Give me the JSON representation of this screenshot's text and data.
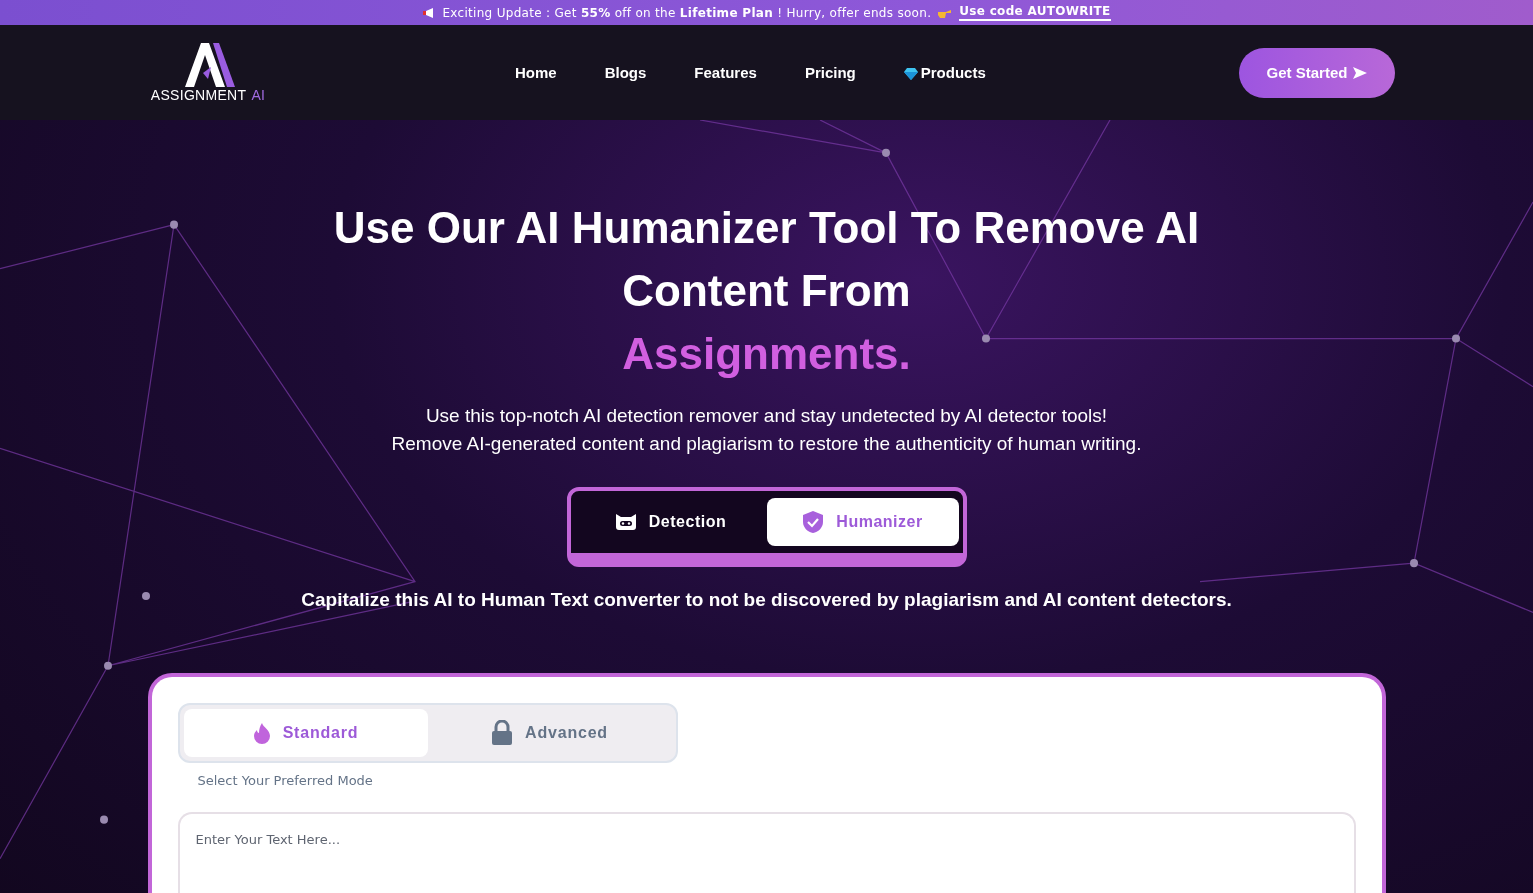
{
  "announcement": {
    "text": "Exciting Update : Get **55%** off on the **Lifetime Plan** ! Hurry, offer ends soon.",
    "link": "Use code **AUTOWRITE**"
  },
  "logo": {
    "name": "ASSIGNMENT",
    "suffix": "AI"
  },
  "nav": [
    {
      "label": "Home",
      "kind": "plain"
    },
    {
      "label": "Blogs",
      "kind": "plain"
    },
    {
      "label": "Features",
      "kind": "plain"
    },
    {
      "label": "Pricing",
      "kind": "plain"
    },
    {
      "label": "Products",
      "kind": "gem"
    }
  ],
  "cta": "Get Started",
  "hero": {
    "title": "Use Our AI Humanizer Tool To Remove AI Content From",
    "highlight": "Assignments.",
    "lines": [
      "Use this top-notch AI detection remover and stay undetected by AI detector tools!",
      "Remove AI-generated content and plagiarism to restore the authenticity of human writing."
    ]
  },
  "tool_tabs": [
    {
      "label": "Detection",
      "kind": "robot",
      "selected": false
    },
    {
      "label": "Humanizer",
      "kind": "shield",
      "selected": true
    }
  ],
  "tagline": "Capitalize this AI to Human Text converter to not be discovered by plagiarism and AI content detectors.",
  "modes": [
    {
      "label": "Standard",
      "kind": "flame",
      "selected": true
    },
    {
      "label": "Advanced",
      "kind": "lock",
      "selected": false
    }
  ],
  "mode_hint": "Select Your Preferred Mode",
  "editor": {
    "placeholder": "Enter Your Text Here..."
  }
}
